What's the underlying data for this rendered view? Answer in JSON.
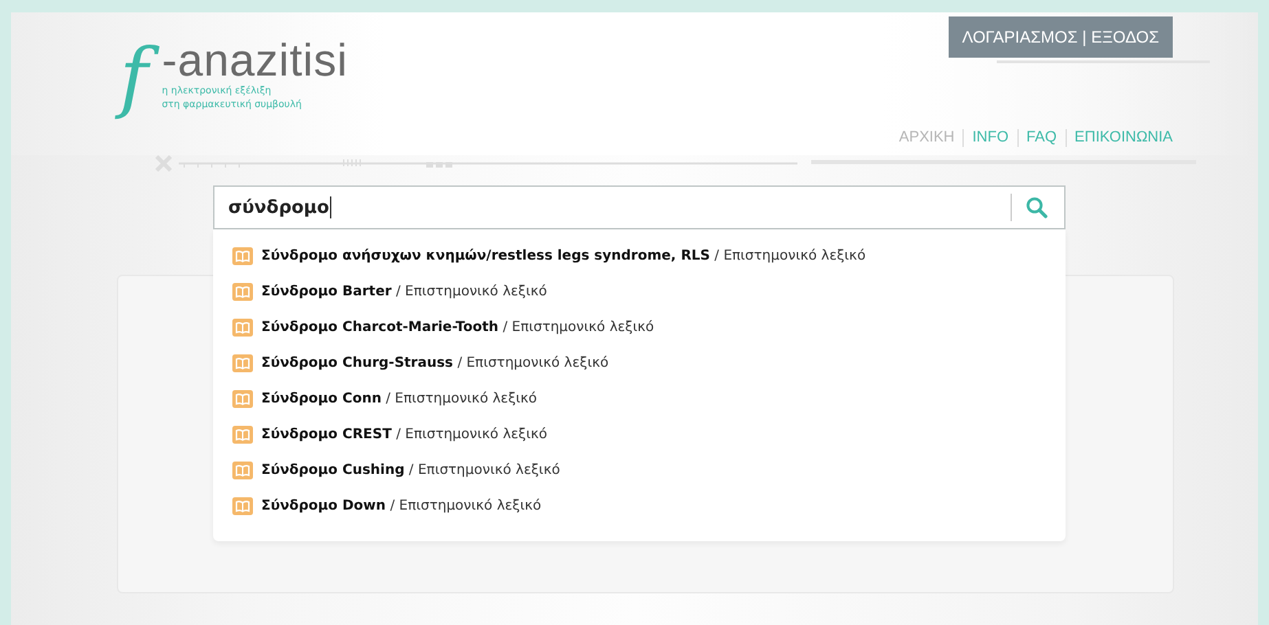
{
  "logo": {
    "mark": "f",
    "name": "-anazitisi",
    "tagline": [
      "η ηλεκτρονική εξέλιξη",
      "στη φαρμακευτική συμβουλή"
    ]
  },
  "account_button": "ΛΟΓΑΡΙΑΣΜΟΣ | ΕΞΟΔΟΣ",
  "nav": [
    {
      "label": "ΑΡΧΙΚΗ",
      "selected": true
    },
    {
      "label": "INFO",
      "selected": false
    },
    {
      "label": "FAQ",
      "selected": false
    },
    {
      "label": "ΕΠΙΚΟΙΝΩΝΙΑ",
      "selected": false
    }
  ],
  "search": {
    "value": "σύνδρομο"
  },
  "suggestions": [
    {
      "term": "Σύνδρομο ανήσυχων κνημών/restless legs syndrome, RLS",
      "source": "/ Επιστημονικό λεξικό"
    },
    {
      "term": "Σύνδρομο Barter",
      "source": "/ Επιστημονικό λεξικό"
    },
    {
      "term": "Σύνδρομο Charcot-Marie-Tooth",
      "source": "/ Επιστημονικό λεξικό"
    },
    {
      "term": "Σύνδρομο Churg-Strauss",
      "source": "/ Επιστημονικό λεξικό"
    },
    {
      "term": "Σύνδρομο Conn",
      "source": "/ Επιστημονικό λεξικό"
    },
    {
      "term": "Σύνδρομο CREST",
      "source": "/ Επιστημονικό λεξικό"
    },
    {
      "term": "Σύνδρομο Cushing",
      "source": "/ Επιστημονικό λεξικό"
    },
    {
      "term": "Σύνδρομο Down",
      "source": "/ Επιστημονικό λεξικό"
    }
  ]
}
